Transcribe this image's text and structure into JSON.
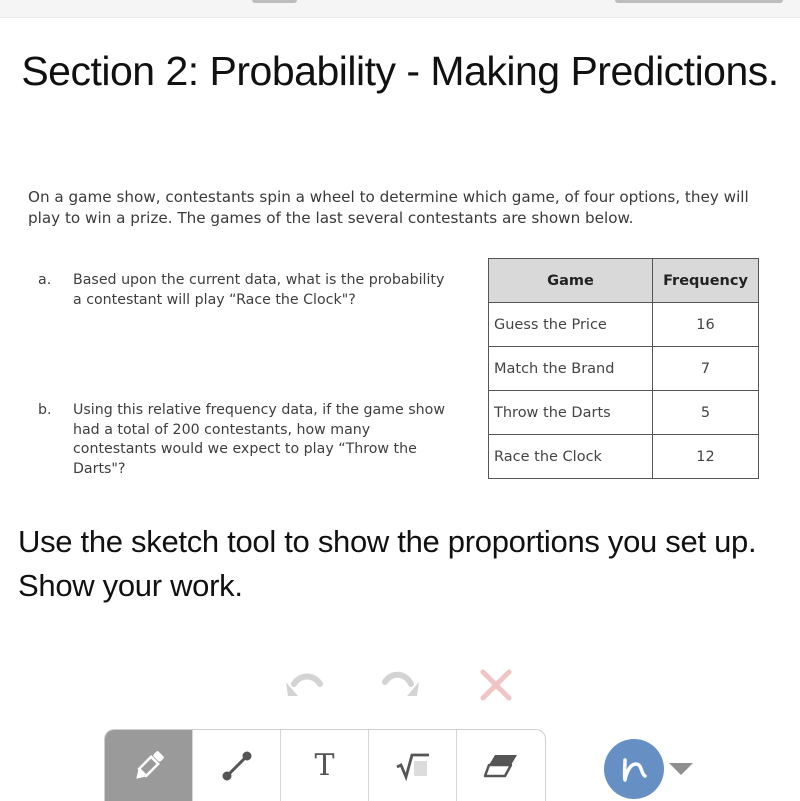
{
  "header": {
    "title": "Section 2: Probability - Making Predictions."
  },
  "passage": "On a game show, contestants spin a wheel to determine which game, of four options, they will play to win a prize. The games of the last several contestants are shown below.",
  "questions": [
    {
      "letter": "a.",
      "text": "Based upon the current data, what is the probability a contestant will play “Race the Clock\"?"
    },
    {
      "letter": "b.",
      "text": "Using this relative frequency data, if the game show had a total of 200 contestants, how many contestants would we expect to play “Throw the Darts\"?"
    }
  ],
  "table": {
    "headers": [
      "Game",
      "Frequency"
    ],
    "rows": [
      {
        "game": "Guess the Price",
        "frequency": "16"
      },
      {
        "game": "Match the Brand",
        "frequency": "7"
      },
      {
        "game": "Throw the Darts",
        "frequency": "5"
      },
      {
        "game": "Race the Clock",
        "frequency": "12"
      }
    ]
  },
  "instruction": "Use the sketch tool to show the proportions you set up. Show your work.",
  "sketch": {
    "actions": [
      {
        "name": "undo",
        "icon": "undo-icon"
      },
      {
        "name": "redo",
        "icon": "redo-icon"
      },
      {
        "name": "clear",
        "icon": "close-icon"
      }
    ],
    "tools": [
      {
        "name": "pencil",
        "icon": "pencil-icon",
        "active": true
      },
      {
        "name": "line",
        "icon": "line-segment-icon",
        "active": false
      },
      {
        "name": "text",
        "icon": "text-icon",
        "glyph": "T",
        "active": false
      },
      {
        "name": "math",
        "icon": "square-root-icon",
        "glyph": "√",
        "active": false
      },
      {
        "name": "eraser",
        "icon": "eraser-icon",
        "active": false
      }
    ],
    "pen_color": "#6690c4",
    "colors": {
      "action_disabled": "#d3d3d3",
      "clear": "#f0c4c4",
      "active_tool_bg": "#9a9a9a"
    }
  }
}
